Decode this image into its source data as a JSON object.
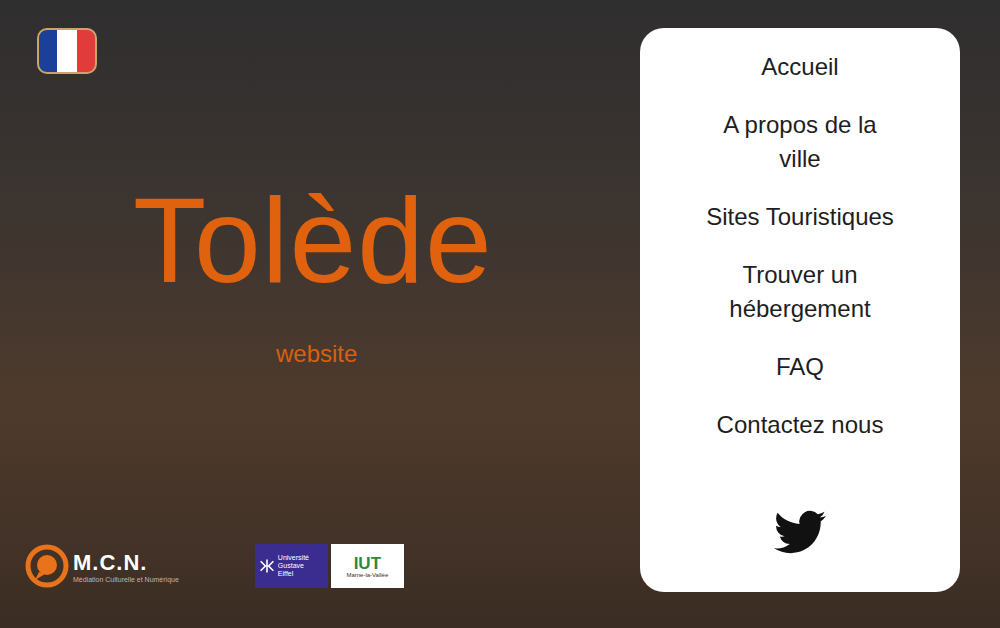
{
  "site": {
    "title": "Tolède",
    "subtitle": "website"
  },
  "menu": {
    "items": [
      {
        "label": "Accueil"
      },
      {
        "label": "A propos de la ville"
      },
      {
        "label": "Sites Touristiques"
      },
      {
        "label": "Trouver un hébergement"
      },
      {
        "label": "FAQ"
      },
      {
        "label": "Contactez nous"
      }
    ]
  },
  "logos": {
    "mcn": {
      "name": "M.C.N.",
      "tagline": "Médiation Culturelle et Numérique"
    },
    "university": {
      "name": "Université Gustave Eiffel"
    },
    "iut": {
      "name": "IUT",
      "place": "Marne-la-Vallée"
    }
  }
}
